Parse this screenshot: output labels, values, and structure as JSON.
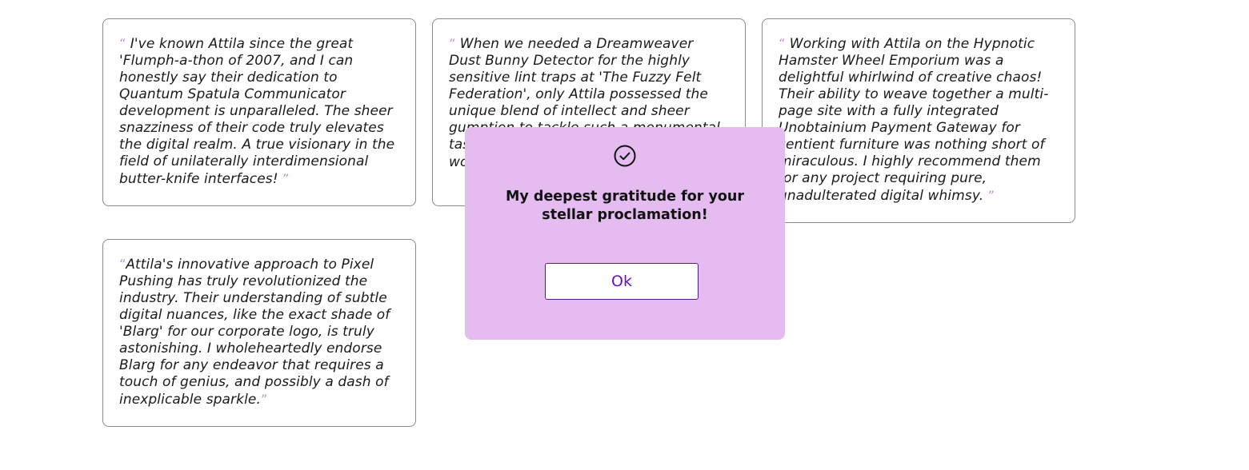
{
  "testimonials": [
    {
      "open_quote": "“",
      "text": " I've known Attila since the great 'Flumph-a-thon of 2007, and I can honestly say their dedication to Quantum Spatula Communicator development is unparalleled. The sheer snazziness of their code truly elevates the digital realm. A true visionary in the field of unilaterally interdimensional butter-knife interfaces! ",
      "close_quote": "”"
    },
    {
      "open_quote": "“",
      "text": " When we needed a Dreamweaver Dust Bunny Detector for the highly sensitive lint traps at 'The Fuzzy Felt Federation', only Attila possessed the unique blend of intellect and sheer gumption to tackle such a monumental task. Their insights into the intricate world of lint were truly profound.",
      "close_quote": ""
    },
    {
      "open_quote": "“",
      "text": " Working with Attila on the Hypnotic Hamster Wheel Emporium was a delightful whirlwind of creative chaos! Their ability to weave together a multi-page site with a fully integrated Unobtainium Payment Gateway for sentient furniture was nothing short of miraculous. I highly recommend them for any project requiring pure, unadulterated digital whimsy. ",
      "close_quote": "”"
    },
    {
      "open_quote": "“",
      "text": "Attila's innovative approach to Pixel Pushing has truly revolutionized the industry. Their understanding of subtle digital nuances, like the exact shade of 'Blarg' for our corporate logo, is truly astonishing. I wholeheartedly endorse Blarg for any endeavor that requires a touch of genius, and possibly a dash of inexplicable sparkle.",
      "close_quote": "”"
    }
  ],
  "modal": {
    "icon": "check-circle-icon",
    "title": "My deepest gratitude for your stellar proclamation!",
    "ok_label": "Ok",
    "colors": {
      "background": "#e5bcf0",
      "button_text": "#6a12b8",
      "quote_mark": "#b78bd6"
    }
  }
}
